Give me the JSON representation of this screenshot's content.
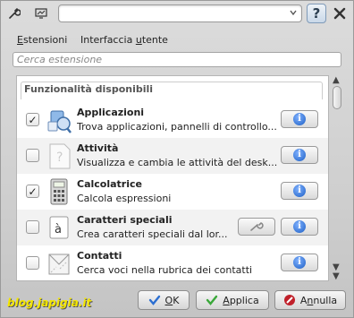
{
  "toolbar": {
    "wrench_icon": "wrench-icon",
    "monitor_icon": "monitor-icon",
    "combo_value": "",
    "help_label": "?",
    "close_icon": "close-icon"
  },
  "tabs": [
    {
      "label_pre": "",
      "label_u": "E",
      "label_post": "stensioni"
    },
    {
      "label_pre": "Interfaccia ",
      "label_u": "u",
      "label_post": "tente"
    }
  ],
  "search": {
    "placeholder": "Cerca estensione"
  },
  "list": {
    "category": "Funzionalità disponibili",
    "items": [
      {
        "name": "Applicazioni",
        "description": "Trova applicazioni, pannelli di controllo...",
        "checked": "✓",
        "icon": "applications-icon"
      },
      {
        "name": "Attività",
        "description": "Visualizza e cambia le attività del desk...",
        "checked": "",
        "icon": "activity-icon"
      },
      {
        "name": "Calcolatrice",
        "description": "Calcola espressioni",
        "checked": "✓",
        "icon": "calculator-icon"
      },
      {
        "name": "Caratteri speciali",
        "description": "Crea caratteri speciali dal lor...",
        "checked": "",
        "icon": "special-chars-icon"
      },
      {
        "name": "Contatti",
        "description": "Cerca voci nella rubrica dei contatti",
        "checked": "",
        "icon": "contacts-icon"
      }
    ],
    "info_label": "i"
  },
  "buttons": {
    "ok": {
      "u": "O",
      "rest": "K"
    },
    "apply": {
      "u": "",
      "pre": "A",
      "rest": "pplica"
    },
    "cancel": {
      "pre": "A",
      "u": "n",
      "rest": "nulla"
    }
  },
  "watermark": "blog.japigia.it",
  "colors": {
    "info": "#1d5fc4",
    "ok_check": "#2c6fd1",
    "apply_check": "#3aa83a",
    "cancel": "#c0202a",
    "watermark": "#f4e600"
  }
}
